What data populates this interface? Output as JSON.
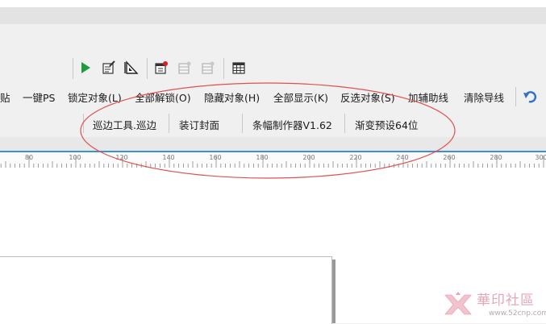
{
  "cmd_toolbar": {
    "items": [
      {
        "id": "paste",
        "label": "贴"
      },
      {
        "id": "one-click-ps",
        "label": "一键PS"
      },
      {
        "id": "lock-object",
        "label": "锁定对象(L)"
      },
      {
        "id": "unlock-all",
        "label": "全部解锁(O)"
      },
      {
        "id": "hide-object",
        "label": "隐藏对象(H)"
      },
      {
        "id": "show-all",
        "label": "全部显示(K)"
      },
      {
        "id": "invert-select",
        "label": "反选对象(S)"
      },
      {
        "id": "add-guides",
        "label": "加辅助线"
      },
      {
        "id": "clear-guides",
        "label": "清除导线"
      }
    ]
  },
  "plugin_toolbar": {
    "items": [
      {
        "id": "edge-tool",
        "label": "巡边工具.巡边"
      },
      {
        "id": "binding-cover",
        "label": "装订封面"
      },
      {
        "id": "strip-maker",
        "label": "条幅制作器V1.62"
      },
      {
        "id": "gradient-preset",
        "label": "渐变预设64位"
      }
    ]
  },
  "icon_toolbar": {
    "icons": [
      "play-icon",
      "edit-page-icon",
      "triangle-ruler-icon",
      "calendar-record-icon",
      "grid-disabled-icon",
      "grid-disabled-icon",
      "calendar-icon"
    ],
    "colors": {
      "play": "#1e9b3a",
      "record_dot": "#d81f1f",
      "undo": "#2b6fd1"
    }
  },
  "ruler": {
    "labels": [
      "80",
      "100",
      "120",
      "140",
      "160",
      "180",
      "200",
      "220",
      "240",
      "260",
      "280",
      "300"
    ]
  },
  "watermark": {
    "title": "華印社區",
    "url": "www.52cnp.com"
  },
  "annotation": {
    "color": "#e05050",
    "shape": "ellipse"
  }
}
